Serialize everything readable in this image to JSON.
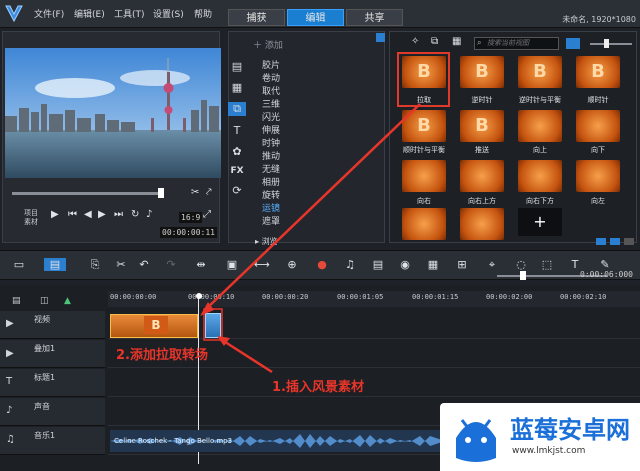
{
  "menu": [
    "文件(F)",
    "编辑(E)",
    "工具(T)",
    "设置(S)",
    "帮助"
  ],
  "tabs": [
    "捕获",
    "编辑",
    "共享"
  ],
  "window_title": "未命名, 1920*1080",
  "player": {
    "project_label": "项目",
    "clip_label": "素材",
    "aspect": "16:9",
    "timecode": "00:00:00:11"
  },
  "library": {
    "add_label": "添加",
    "categories": [
      "胶片",
      "卷动",
      "取代",
      "三维",
      "闪光",
      "伸展",
      "时钟",
      "推动",
      "无缝",
      "相册",
      "旋转",
      "运镜",
      "遮罩"
    ],
    "selected_category": "运镜",
    "browse_label": "浏览",
    "search_placeholder": "搜索当前视图",
    "transitions": [
      "拉取",
      "逆时针",
      "逆时针与平衡",
      "顺时针",
      "顺时针与平衡",
      "推送",
      "向上",
      "向下",
      "向右",
      "向右上方",
      "向右下方",
      "向左"
    ]
  },
  "timeline": {
    "ruler_times": [
      "00:00:00:00",
      "00:00:00:10",
      "00:00:00:20",
      "00:00:01:05",
      "00:00:01:15",
      "00:00:02:00",
      "00:00:02:10"
    ],
    "zoom_timecode": "0:00:06:000",
    "tracks": [
      {
        "name": "视频"
      },
      {
        "name": "叠加1"
      },
      {
        "name": "标题1"
      },
      {
        "name": "声音"
      },
      {
        "name": "音乐1"
      }
    ],
    "audio_clip": "Celine Roschek - Tango Bello.mp3"
  },
  "annotations": {
    "step1": "1.插入风景素材",
    "step2": "2.添加拉取转场"
  },
  "watermark": {
    "title": "蓝莓安卓网",
    "url": "www.lmkjst.com"
  },
  "colors": {
    "accent": "#1a7fd1",
    "annotation": "#e8352a",
    "transition_thumb": "#e07a2a"
  }
}
